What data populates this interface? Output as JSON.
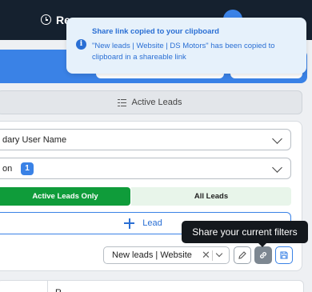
{
  "topbar": {
    "title": "Re"
  },
  "active_header": {
    "label": "Active Leads",
    "icon": "list-icon"
  },
  "fields": {
    "user_name": "dary User Name",
    "location": "on",
    "location_count": "1"
  },
  "toggle": {
    "active_only": "Active Leads Only",
    "all": "All Leads"
  },
  "add_lead": {
    "label": "Lead",
    "icon": "plus-icon"
  },
  "filter": {
    "selected": "New leads | Website",
    "clear_symbol": "✕"
  },
  "tooltip": {
    "text": "Share your current filters"
  },
  "toast": {
    "title": "Share link copied to your clipboard",
    "body": "\"New leads | Website | DS Motors\" has been copied to clipboard in a shareable link",
    "icon": "info-icon"
  },
  "bottom": {
    "label": "R"
  },
  "colors": {
    "topbar": "#15212f",
    "accent": "#3a82e6",
    "active_green": "#0f9c3a",
    "toast_bg": "#e6f1fb",
    "tooltip_bg": "#14181d"
  }
}
